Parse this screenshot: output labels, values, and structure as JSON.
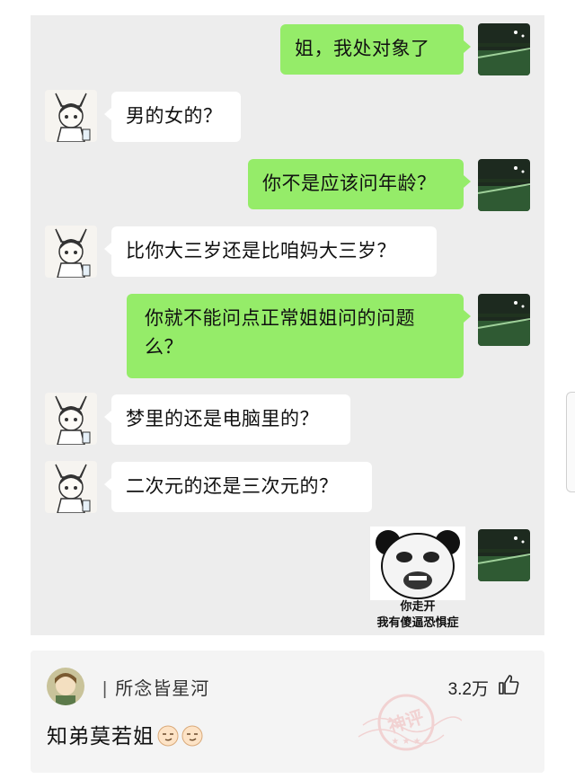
{
  "chat": {
    "messages": [
      {
        "side": "right",
        "text": "姐，我处对象了"
      },
      {
        "side": "left",
        "text": "男的女的？"
      },
      {
        "side": "right",
        "text": "你不是应该问年龄？"
      },
      {
        "side": "left",
        "text": "比你大三岁还是比咱妈大三岁？"
      },
      {
        "side": "right",
        "text": "你就不能问点正常姐姐问的问题么？"
      },
      {
        "side": "left",
        "text": "梦里的还是电脑里的？"
      },
      {
        "side": "left",
        "text": "二次元的还是三次元的？"
      }
    ],
    "sticker": {
      "icon": "panda-meme-sticker",
      "line1": "你走开",
      "line2": "我有傻逼恐惧症"
    }
  },
  "comment": {
    "username": "所念皆星河",
    "likes": "3.2万",
    "text": "知弟莫若姐",
    "stamp_text": "神评",
    "icons": [
      "thumbs-up-icon",
      "smirk-emoji-icon",
      "smirk-emoji-icon"
    ]
  },
  "colors": {
    "chat_bg": "#ededed",
    "bubble_right": "#95ec69",
    "bubble_left": "#ffffff",
    "comment_bg": "#f4f4f4",
    "stamp": "#f0b8b8"
  }
}
